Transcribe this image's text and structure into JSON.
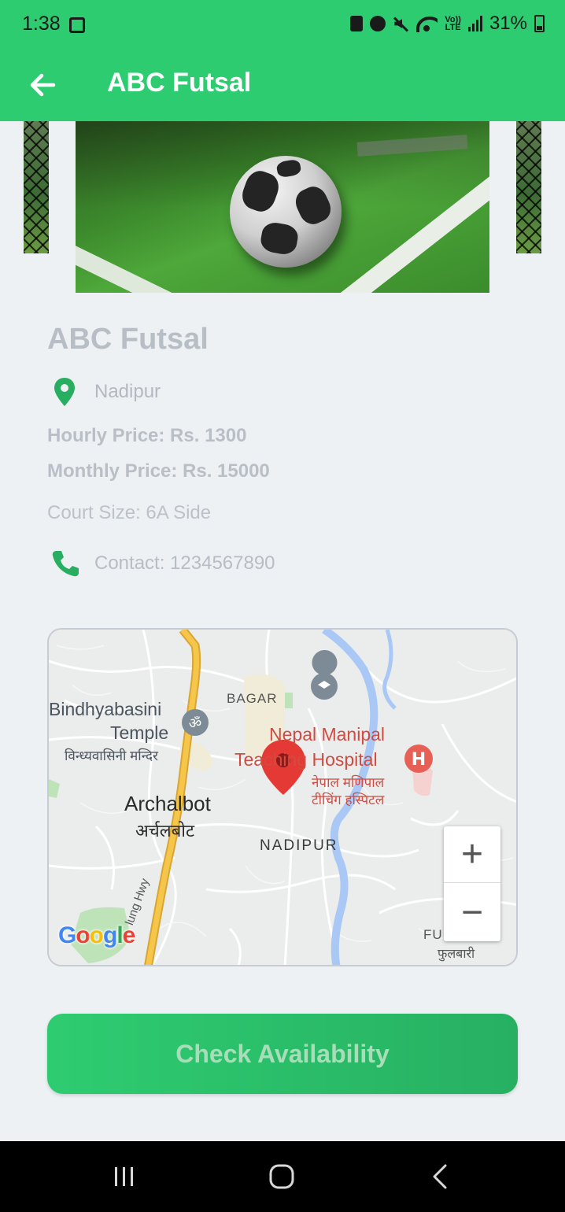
{
  "status_bar": {
    "time": "1:38",
    "volte_top": "Vo))",
    "volte_bottom": "LTE",
    "battery": "31%"
  },
  "app_bar": {
    "title": "ABC Futsal"
  },
  "venue": {
    "name": "ABC Futsal",
    "location": "Nadipur",
    "hourly_price": "Hourly Price: Rs. 1300",
    "monthly_price": "Monthly Price: Rs. 15000",
    "court_size": "Court Size: 6A Side",
    "contact": "Contact: 1234567890"
  },
  "map": {
    "labels": {
      "bagar": "BAGAR",
      "temple_en_1": "Bindhyabasini",
      "temple_en_2": "Temple",
      "temple_ne": "विन्ध्यवासिनी मन्दिर",
      "hospital_1": "Nepal Manipal",
      "hospital_2": "Teaching Hospital",
      "hospital_ne_1": "नेपाल मणिपाल",
      "hospital_ne_2": "टीचिंग हस्पिटल",
      "archalbot_en": "Archalbot",
      "archalbot_ne": "अर्चलबोट",
      "nadipur": "NADIPUR",
      "fulbari_en": "FULBARI",
      "fulbari_ne": "फुलबारी",
      "highway": "lung Hwy"
    },
    "zoom_in": "+",
    "zoom_out": "−",
    "google": [
      "G",
      "o",
      "o",
      "g",
      "l",
      "e"
    ],
    "colors": {
      "pin": "#e53935",
      "road_major": "#f6c64a",
      "river": "#a9c8f5",
      "park": "#b7e0b0",
      "hospital": "#e66055",
      "poi": "#7d8b97"
    }
  },
  "cta": {
    "label": "Check Availability"
  },
  "colors": {
    "primary": "#2ecc71",
    "accent_icon": "#27ae60"
  }
}
